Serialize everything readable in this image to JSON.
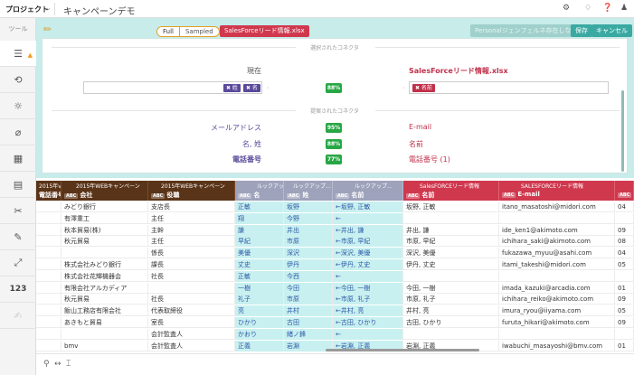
{
  "topbar": {
    "project_label": "プロジェクト",
    "title": "キャンペーンデモ",
    "icons": [
      "gear-icon",
      "bell-icon",
      "help-icon",
      "user-icon"
    ]
  },
  "sidebar": {
    "tool_label": "ツール",
    "items": [
      "list-warning-icon",
      "history-icon",
      "sun-icon",
      "clip-icon",
      "grid-icon",
      "calc-icon",
      "scissors-icon",
      "dropper-icon",
      "expand-icon",
      "123",
      "edit-icon"
    ],
    "number_label": "123"
  },
  "panel": {
    "mode_full": "Full",
    "mode_sampled": "Sampled",
    "file_badge": "SalesForceリード情報.xlsx",
    "btn_disabled": "Personalジェンフェルネ存在しない",
    "btn_save": "保存",
    "btn_cancel": "キャンセル",
    "selected_label": "選択されたコネクタ",
    "suggested_label": "提案されたコネクタ",
    "selected": {
      "left_title": "現在",
      "right_title": "SalesForceリード情報.xlsx",
      "left_tags": [
        "✖ 姓",
        "✖ 名"
      ],
      "percent": "88%",
      "right_tags": [
        "✖ 名前"
      ]
    },
    "suggestions": [
      {
        "left": "メールアドレス",
        "percent": "95%",
        "right": "E-mail"
      },
      {
        "left": "名, 姓",
        "percent": "88%",
        "right": "名前"
      },
      {
        "left": "電話番号",
        "percent": "77%",
        "right": "電話番号 (1)"
      }
    ]
  },
  "grid": {
    "headers": [
      {
        "src": "2015年v",
        "type": "ABC",
        "name": "電話番号"
      },
      {
        "src": "2015年WEBキャンペーン",
        "type": "ABC",
        "name": "会社"
      },
      {
        "src": "2015年WEBキャンペーン",
        "type": "ABC",
        "name": "役職"
      },
      {
        "src": "ルックアップ…",
        "type": "ABC",
        "name": "名"
      },
      {
        "src": "ルックアップ…",
        "type": "ABC",
        "name": "姓"
      },
      {
        "src": "ルックアップ…",
        "type": "ABC",
        "name": "名前"
      },
      {
        "src": "SalesFORCEリード情報",
        "type": "ABC",
        "name": "名前"
      },
      {
        "src": "SALESFORCEリード情報",
        "type": "ABC",
        "name": "E-mail"
      },
      {
        "src": "",
        "type": "ABC",
        "name": ""
      }
    ],
    "rows": [
      [
        "",
        "みどり銀行",
        "支店長",
        "正敏",
        "坂野",
        "←坂野, 正敏",
        "坂野, 正敏",
        "itano_masatoshi@midori.com",
        "04"
      ],
      [
        "",
        "有澤重工",
        "主任",
        "翔",
        "今野",
        "←",
        "",
        "",
        ""
      ],
      [
        "",
        "秋本貿易(株)",
        "主幹",
        "謙",
        "井出",
        "←井出, 謙",
        "井出, 謙",
        "ide_ken1@akimoto.com",
        "09"
      ],
      [
        "",
        "秋元貿易",
        "主任",
        "早紀",
        "市原",
        "←市原, 早紀",
        "市原, 早紀",
        "ichihara_saki@akimoto.com",
        "08"
      ],
      [
        "",
        "",
        "係長",
        "美優",
        "深沢",
        "←深沢, 美優",
        "深沢, 美優",
        "fukazawa_myuu@asahi.com",
        "04"
      ],
      [
        "",
        "株式会社みどり銀行",
        "課長",
        "丈史",
        "伊丹",
        "←伊丹, 丈史",
        "伊丹, 丈史",
        "itami_takeshi@midori.com",
        "05"
      ],
      [
        "",
        "株式会社花輝機器会",
        "社長",
        "正敏",
        "今西",
        "←",
        "",
        "",
        ""
      ],
      [
        "",
        "有限会社アルカディア",
        "",
        "一樹",
        "今田",
        "←今田, 一樹",
        "今田, 一樹",
        "imada_kazuki@arcadia.com",
        "01"
      ],
      [
        "",
        "秋元貿易",
        "社長",
        "礼子",
        "市原",
        "←市原, 礼子",
        "市原, 礼子",
        "ichihara_reiko@akimoto.com",
        "09"
      ],
      [
        "",
        "飯山工務店有限会社",
        "代表取締役",
        "亮",
        "井村",
        "←井村, 亮",
        "井村, 亮",
        "imura_ryou@iiyama.com",
        "05"
      ],
      [
        "",
        "あきもと貿易",
        "室長",
        "ひかり",
        "古田",
        "←古田, ひかり",
        "古田, ひかり",
        "furuta_hikari@akimoto.com",
        "09"
      ],
      [
        "",
        "",
        "会計監査人",
        "かおり",
        "緒ノ鋒",
        "←",
        "",
        "",
        ""
      ],
      [
        "",
        "bmv",
        "会計監査人",
        "正義",
        "岩淵",
        "←岩淵, 正義",
        "岩淵, 正義",
        "iwabuchi_masayoshi@bmv.com",
        "01"
      ]
    ]
  },
  "bottombar": {
    "icons": [
      "search-icon",
      "resize-icon",
      "text-icon"
    ]
  }
}
